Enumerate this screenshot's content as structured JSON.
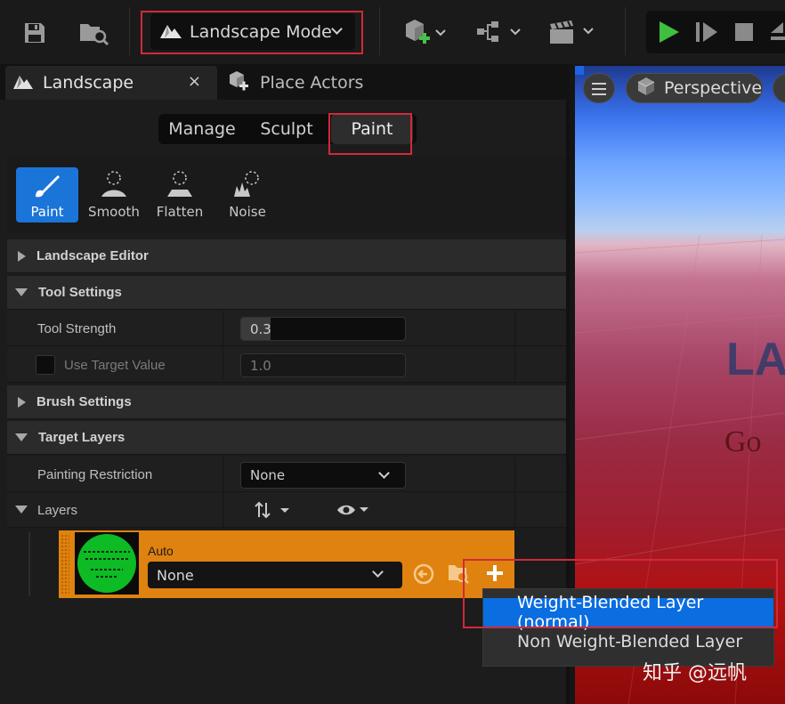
{
  "toolbar": {
    "mode_label": "Landscape Mode",
    "icons": [
      "save-icon",
      "content-browser-icon",
      "landscape-mode-icon",
      "add-actor-icon",
      "blueprint-icon",
      "cinematics-icon",
      "play-icon",
      "advance-frame-icon",
      "stop-icon",
      "eject-icon"
    ]
  },
  "tabs": {
    "landscape": "Landscape",
    "close": "×",
    "place_actors": "Place Actors"
  },
  "mode_tabs": [
    "Manage",
    "Sculpt",
    "Paint"
  ],
  "tools": [
    {
      "label": "Paint",
      "icon": "paint-brush-icon",
      "active": true
    },
    {
      "label": "Smooth",
      "icon": "smooth-icon"
    },
    {
      "label": "Flatten",
      "icon": "flatten-icon"
    },
    {
      "label": "Noise",
      "icon": "noise-icon"
    }
  ],
  "sections": {
    "landscape_editor": "Landscape Editor",
    "tool_settings": "Tool Settings",
    "brush_settings": "Brush Settings",
    "target_layers": "Target Layers"
  },
  "properties": {
    "tool_strength": {
      "label": "Tool Strength",
      "value": "0.3",
      "fraction": 0.3
    },
    "use_target_value": {
      "label": "Use Target Value",
      "value": "1.0",
      "checked": false
    },
    "painting_restriction": {
      "label": "Painting Restriction",
      "value": "None"
    },
    "layers": {
      "label": "Layers"
    }
  },
  "layer_item": {
    "name": "Auto",
    "selected": "None"
  },
  "popup": {
    "items": [
      "Weight-Blended Layer (normal)",
      "Non Weight-Blended Layer"
    ]
  },
  "viewport": {
    "perspective": "Perspective",
    "overlay_text_1": "LA",
    "overlay_text_2": "Go"
  },
  "watermark": "知乎 @远帆",
  "colors": {
    "accent": "#1b74d8",
    "layer_highlight": "#df8210",
    "annotation": "#d1293a",
    "play_green": "#3fbf3f"
  }
}
